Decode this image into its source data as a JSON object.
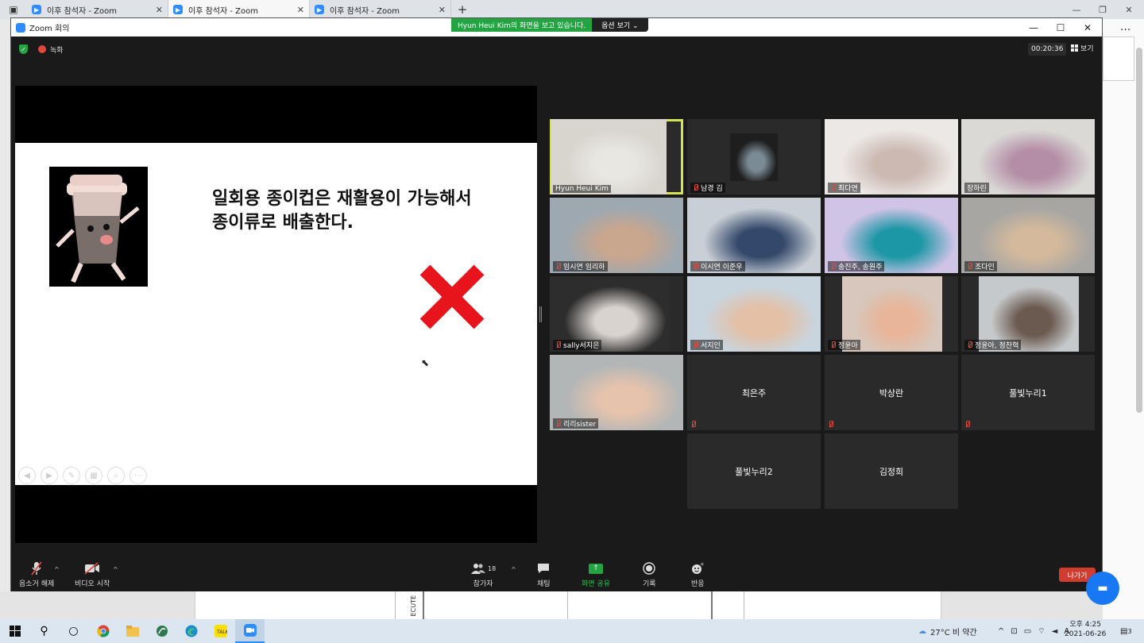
{
  "browser": {
    "tabs": [
      {
        "label": "이후 참석자 - Zoom",
        "active": false
      },
      {
        "label": "이후 참석자 - Zoom",
        "active": true
      },
      {
        "label": "이후 참석자 - Zoom",
        "active": false
      }
    ],
    "new_tab": "+",
    "menu_dots": "···"
  },
  "zoom": {
    "window_title": "Zoom 회의",
    "share_banner": {
      "text": "Hyun Heui Kim의 화면을 보고 있습니다.",
      "options": "옵션 보기 ⌄"
    },
    "recording_label": "녹화",
    "timer": "00:20:36",
    "view_label": "보기",
    "slide": {
      "line1": "일회용 종이컵은 재활용이 가능해서",
      "line2": "종이류로 배출한다."
    },
    "participants": [
      {
        "name": "Hyun Heui Kim",
        "muted": false,
        "video": true,
        "speaking": true
      },
      {
        "name": "남경 김",
        "muted": true,
        "video": true
      },
      {
        "name": "최다연",
        "muted": true,
        "video": true
      },
      {
        "name": "장하린",
        "muted": false,
        "video": true
      },
      {
        "name": "임시연 임리하",
        "muted": true,
        "video": true
      },
      {
        "name": "이시연 이준우",
        "muted": true,
        "video": true
      },
      {
        "name": "송진주, 송원주",
        "muted": true,
        "video": true
      },
      {
        "name": "조다인",
        "muted": true,
        "video": true
      },
      {
        "name": "sally서지은",
        "muted": true,
        "video": true
      },
      {
        "name": "서지인",
        "muted": true,
        "video": true
      },
      {
        "name": "정윤아",
        "muted": true,
        "video": true
      },
      {
        "name": "정윤아, 정찬혁",
        "muted": true,
        "video": true
      },
      {
        "name": "리리sister",
        "muted": true,
        "video": true
      },
      {
        "name": "최은주",
        "muted": true,
        "video": false
      },
      {
        "name": "박상란",
        "muted": true,
        "video": false
      },
      {
        "name": "풀빛누리1",
        "muted": true,
        "video": false
      },
      {
        "name": "풀빛누리2",
        "muted": false,
        "video": false
      },
      {
        "name": "김정희",
        "muted": false,
        "video": false
      }
    ],
    "toolbar": {
      "unmute": "음소거 해제",
      "start_video": "비디오 시작",
      "participants": "참가자",
      "participants_count": "18",
      "chat": "채팅",
      "share": "화면 공유",
      "record": "기록",
      "reactions": "반응",
      "leave": "나가기"
    }
  },
  "background_doc": {
    "vertical_text": "ECUTE"
  },
  "taskbar": {
    "weather": "27°C  비 약간",
    "time": "오후 4:25",
    "date": "2021-06-26",
    "ime": "A",
    "notifications": "3"
  },
  "colors": {
    "zoom_blue": "#2d8cff",
    "share_green": "#23a342",
    "leave_red": "#d13c2f",
    "speaker_outline": "#d6e54e",
    "x_red": "#e8141c"
  }
}
